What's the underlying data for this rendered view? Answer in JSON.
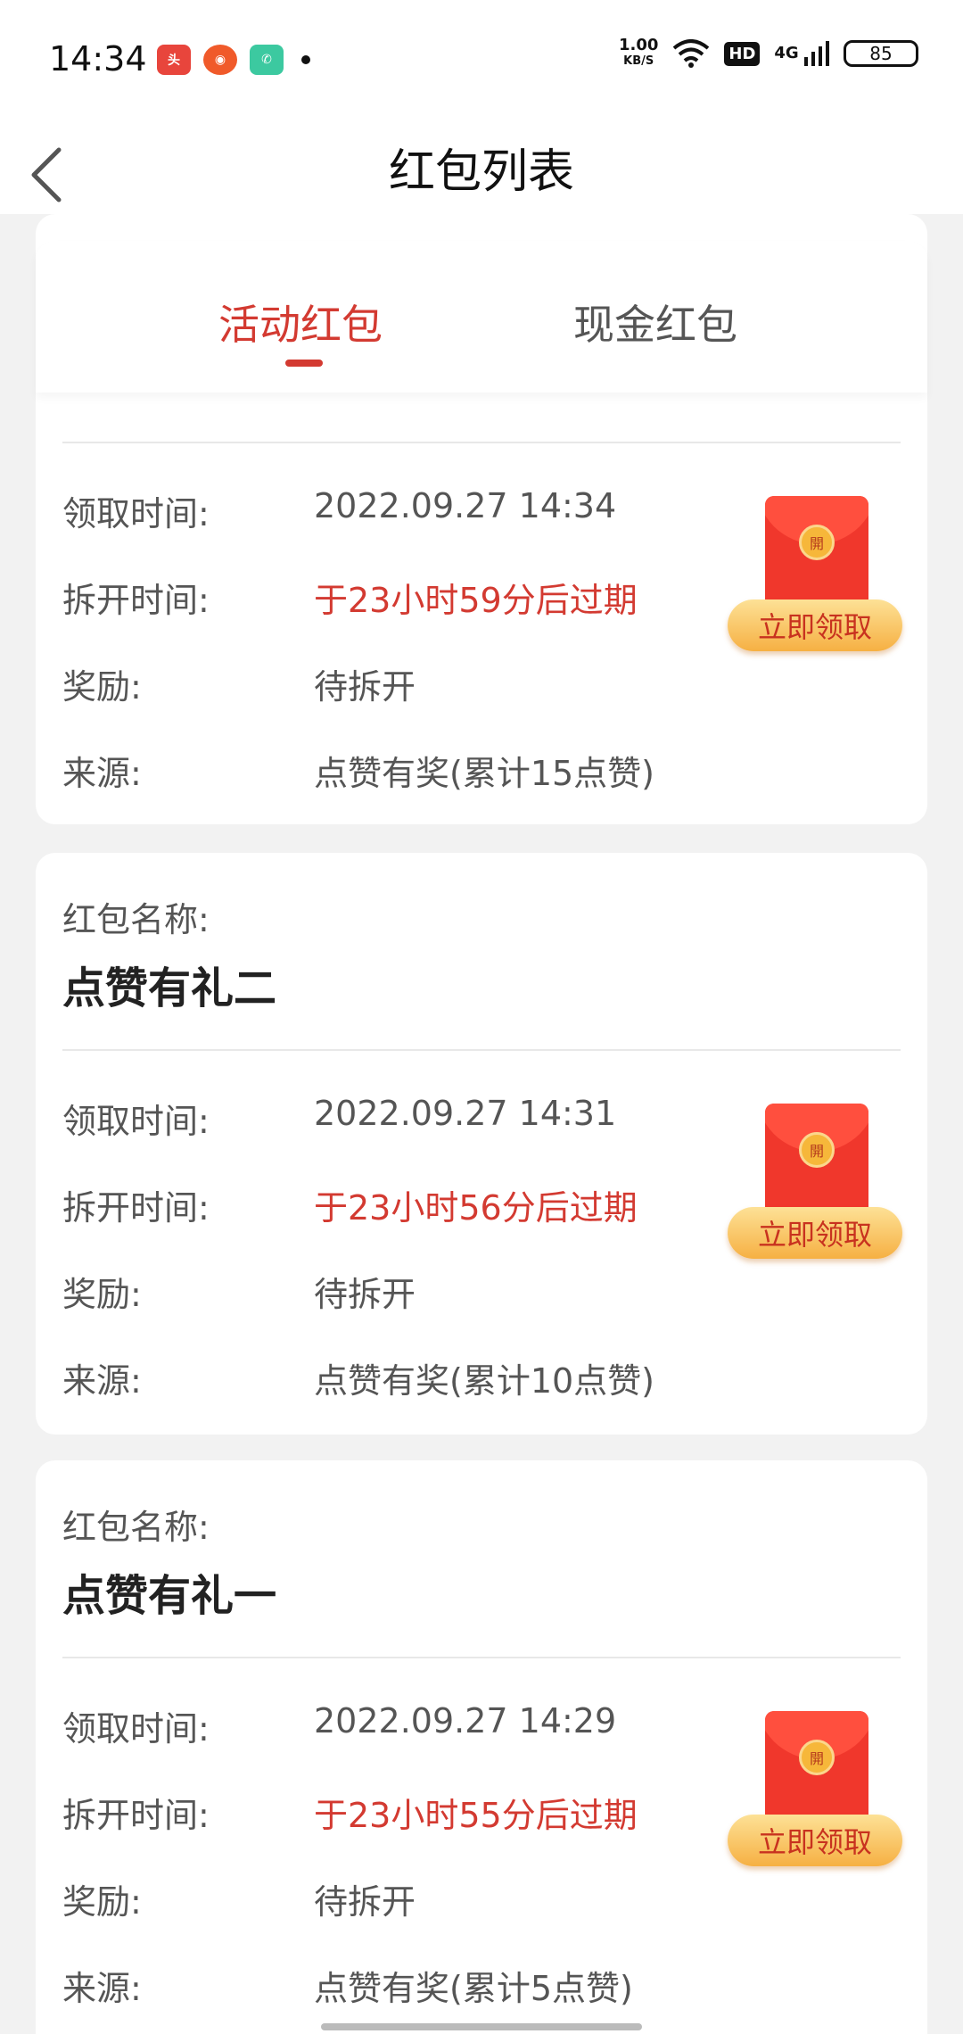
{
  "status": {
    "time": "14:34",
    "speed_value": "1.00",
    "speed_unit": "KB/S",
    "hd": "HD",
    "network": "4G",
    "battery": "85"
  },
  "header": {
    "title": "红包列表"
  },
  "tabs": [
    {
      "label": "活动红包",
      "active": true
    },
    {
      "label": "现金红包",
      "active": false
    }
  ],
  "labels": {
    "name": "红包名称:",
    "receive_time": "领取时间:",
    "open_time": "拆开时间:",
    "reward": "奖励:",
    "source": "来源:",
    "claim": "立即领取",
    "seal": "開"
  },
  "packets": [
    {
      "name": "",
      "receive_time": "2022.09.27 14:34",
      "open_time": "于23小时59分后过期",
      "reward": "待拆开",
      "source": "点赞有奖(累计15点赞)"
    },
    {
      "name": "点赞有礼二",
      "receive_time": "2022.09.27 14:31",
      "open_time": "于23小时56分后过期",
      "reward": "待拆开",
      "source": "点赞有奖(累计10点赞)"
    },
    {
      "name": "点赞有礼一",
      "receive_time": "2022.09.27 14:29",
      "open_time": "于23小时55分后过期",
      "reward": "待拆开",
      "source": "点赞有奖(累计5点赞)"
    }
  ],
  "colors": {
    "accent": "#d33a31",
    "envelope": "#f0372c",
    "button": "#f6b043"
  }
}
